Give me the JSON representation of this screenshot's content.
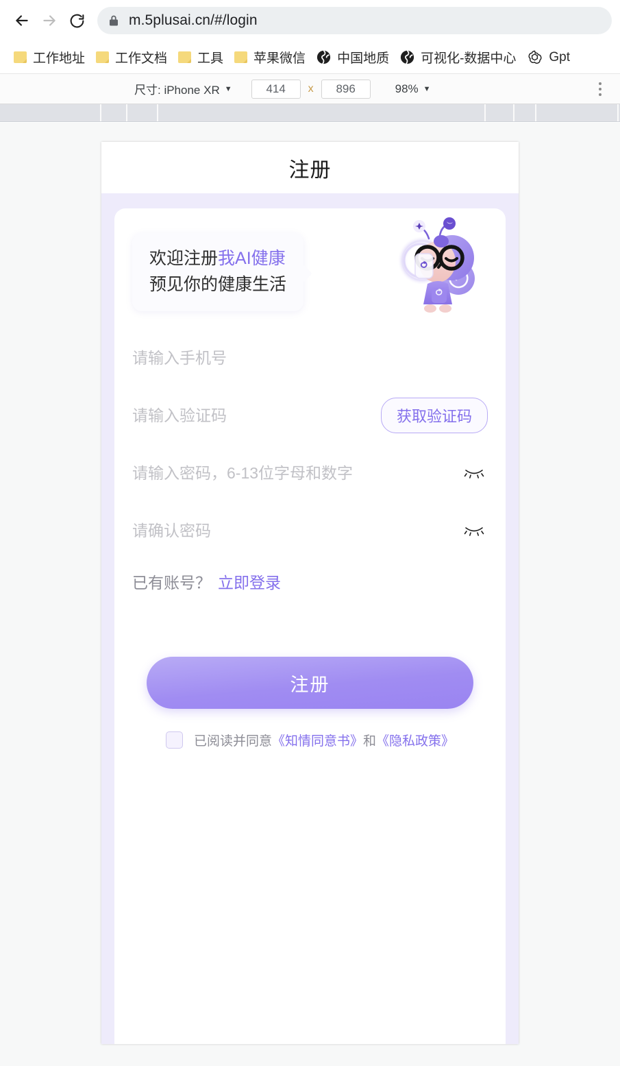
{
  "browser": {
    "back_icon": "back-arrow-icon",
    "forward_icon": "forward-arrow-icon",
    "reload_icon": "reload-icon",
    "lock_icon": "lock-icon",
    "url": "m.5plusai.cn/#/login",
    "menu_icon": "three-dot-menu-icon"
  },
  "bookmarks": [
    {
      "label": "工作地址",
      "icon": "folder-icon"
    },
    {
      "label": "工作文档",
      "icon": "folder-icon"
    },
    {
      "label": "工具",
      "icon": "folder-icon"
    },
    {
      "label": "苹果微信",
      "icon": "folder-icon"
    },
    {
      "label": "中国地质",
      "icon": "globe-icon"
    },
    {
      "label": "可视化-数据中心",
      "icon": "globe-icon"
    },
    {
      "label": "Gpt",
      "icon": "openai-icon"
    }
  ],
  "device_toolbar": {
    "size_label": "尺寸: iPhone XR",
    "width": "414",
    "separator": "x",
    "height": "896",
    "zoom": "98%",
    "caret": "▼"
  },
  "page": {
    "title": "注册",
    "welcome": {
      "line1_prefix": "欢迎注册",
      "line1_brand": "我AI健康",
      "line2": "预见你的健康生活",
      "mascot_icon": "snail-mascot-illustration"
    },
    "fields": [
      {
        "name": "phone",
        "placeholder": "请输入手机号",
        "value": ""
      },
      {
        "name": "code",
        "placeholder": "请输入验证码",
        "value": ""
      },
      {
        "name": "password",
        "placeholder": "请输入密码，6-13位字母和数字",
        "value": ""
      },
      {
        "name": "confirm",
        "placeholder": "请确认密码",
        "value": ""
      }
    ],
    "get_code_button": "获取验证码",
    "eye_icon": "eye-closed-icon",
    "login_prompt": "已有账号？",
    "login_link": "立即登录",
    "submit_button": "注册",
    "agreement": {
      "prefix": "已阅读并同意",
      "doc1": "《知情同意书》",
      "conjunction": "和",
      "doc2": "《隐私政策》",
      "checked": false
    }
  },
  "colors": {
    "brand_purple": "#8470ec",
    "page_bg": "#eeebfb",
    "card_bg": "#ffffff",
    "placeholder": "#c1c1c6"
  }
}
